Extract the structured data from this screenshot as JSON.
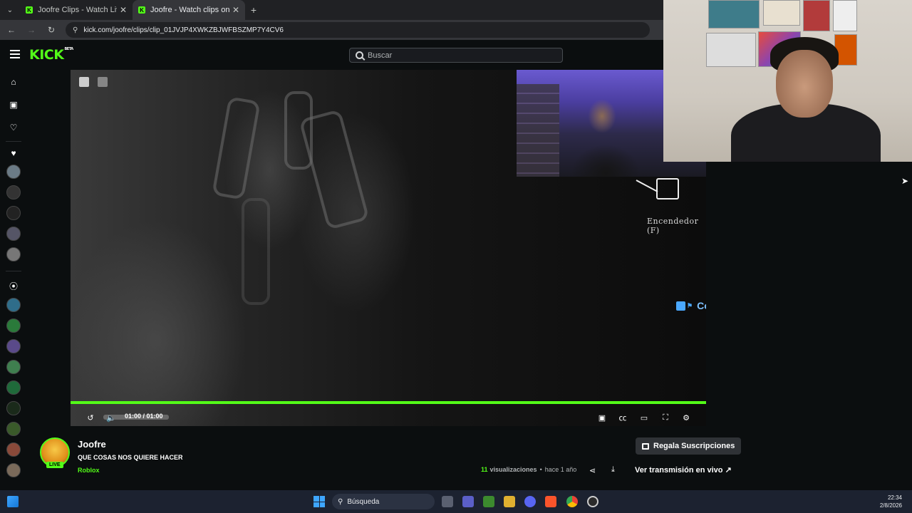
{
  "browser": {
    "tabs": [
      {
        "title": "Joofre Clips - Watch Live on Kick"
      },
      {
        "title": "Joofre - Watch clips on Kick"
      }
    ],
    "new_tab_glyph": "+",
    "url": "kick.com/joofre/clips/clip_01JVJP4XWKZBJWFBSZMP7Y4CV6"
  },
  "header": {
    "logo": "KICK",
    "logo_badge": "BETA",
    "search_placeholder": "Buscar"
  },
  "player": {
    "hud_label": "Encendedor (F)",
    "chat": {
      "username": "Compa_Pesito",
      "separator": ":"
    },
    "time": "01:00 / 01:00",
    "progress": 1.0
  },
  "clip": {
    "channel": "Joofre",
    "live_badge": "LIVE",
    "title": "QUE COSAS NOS QUIERE HACER",
    "category": "Roblox",
    "gift_label": "Regala Suscripciones",
    "views_count": "11",
    "views_label": "visualizaciones",
    "age": "hace 1 año",
    "watch_live_label": "Ver transmisión en vivo"
  },
  "taskbar": {
    "search_label": "Búsqueda",
    "time": "22:34",
    "date": "2/8/2026"
  },
  "colors": {
    "accent": "#53fc18",
    "background": "#0b0e0f"
  }
}
